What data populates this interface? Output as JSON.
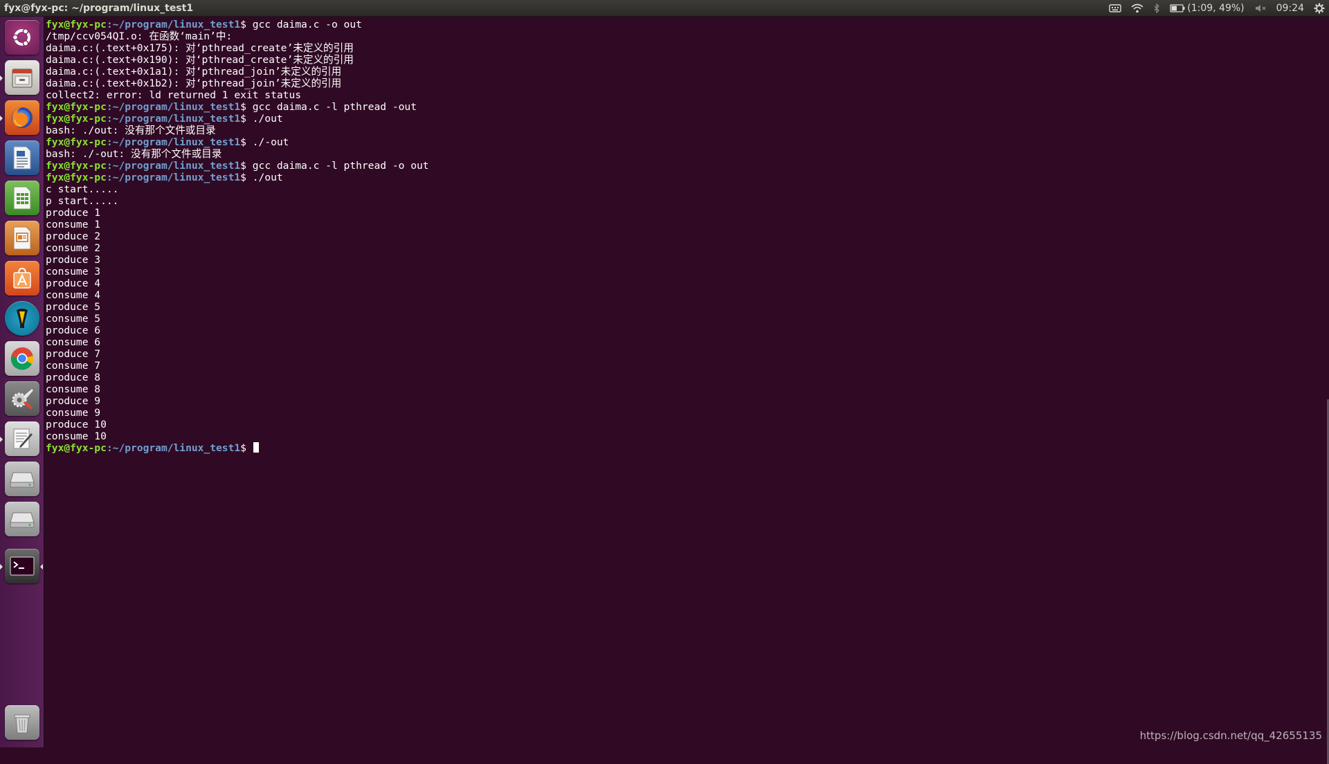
{
  "topbar": {
    "window_title": "fyx@fyx-pc: ~/program/linux_test1",
    "battery_text": "(1:09, 49%)",
    "clock": "09:24",
    "icons": [
      "keyboard-icon",
      "wifi-icon",
      "bluetooth-icon",
      "battery-icon",
      "volume-muted-icon",
      "gear-icon"
    ]
  },
  "launcher": {
    "items": [
      {
        "name": "ubuntu-dash",
        "icon": "ubuntu-logo-icon"
      },
      {
        "name": "files",
        "icon": "file-cabinet-icon"
      },
      {
        "name": "firefox",
        "icon": "firefox-icon"
      },
      {
        "name": "libreoffice-writer",
        "icon": "document-icon"
      },
      {
        "name": "libreoffice-calc",
        "icon": "spreadsheet-icon"
      },
      {
        "name": "libreoffice-impress",
        "icon": "presentation-icon"
      },
      {
        "name": "software-center",
        "icon": "shopping-bag-icon"
      },
      {
        "name": "app-teal",
        "icon": "pen-tool-icon"
      },
      {
        "name": "chrome",
        "icon": "chrome-icon"
      },
      {
        "name": "system-settings",
        "icon": "settings-tools-icon"
      },
      {
        "name": "text-editor",
        "icon": "text-editor-icon"
      },
      {
        "name": "disk-1",
        "icon": "disk-drive-icon"
      },
      {
        "name": "disk-2",
        "icon": "disk-drive-icon"
      },
      {
        "name": "terminal",
        "icon": "terminal-icon"
      }
    ],
    "trash": {
      "name": "trash",
      "icon": "trash-icon"
    }
  },
  "terminal": {
    "prompt_user": "fyx@fyx-pc",
    "prompt_path": ":~/program/linux_test1",
    "prompt_dollar": "$ ",
    "lines": [
      {
        "kind": "cmd",
        "text": "gcc daima.c -o out"
      },
      {
        "kind": "out",
        "text": "/tmp/ccv054QI.o: 在函数‘main’中:"
      },
      {
        "kind": "out",
        "text": "daima.c:(.text+0x175): 对‘pthread_create’未定义的引用"
      },
      {
        "kind": "out",
        "text": "daima.c:(.text+0x190): 对‘pthread_create’未定义的引用"
      },
      {
        "kind": "out",
        "text": "daima.c:(.text+0x1a1): 对‘pthread_join’未定义的引用"
      },
      {
        "kind": "out",
        "text": "daima.c:(.text+0x1b2): 对‘pthread_join’未定义的引用"
      },
      {
        "kind": "out",
        "text": "collect2: error: ld returned 1 exit status"
      },
      {
        "kind": "cmd",
        "text": "gcc daima.c -l pthread -out"
      },
      {
        "kind": "cmd",
        "text": "./out"
      },
      {
        "kind": "out",
        "text": "bash: ./out: 没有那个文件或目录"
      },
      {
        "kind": "cmd",
        "text": "./-out"
      },
      {
        "kind": "out",
        "text": "bash: ./-out: 没有那个文件或目录"
      },
      {
        "kind": "cmd",
        "text": "gcc daima.c -l pthread -o out"
      },
      {
        "kind": "cmd",
        "text": "./out"
      },
      {
        "kind": "out",
        "text": "c start....."
      },
      {
        "kind": "out",
        "text": "p start....."
      },
      {
        "kind": "out",
        "text": "produce 1"
      },
      {
        "kind": "out",
        "text": "consume 1"
      },
      {
        "kind": "out",
        "text": "produce 2"
      },
      {
        "kind": "out",
        "text": "consume 2"
      },
      {
        "kind": "out",
        "text": "produce 3"
      },
      {
        "kind": "out",
        "text": "consume 3"
      },
      {
        "kind": "out",
        "text": "produce 4"
      },
      {
        "kind": "out",
        "text": "consume 4"
      },
      {
        "kind": "out",
        "text": "produce 5"
      },
      {
        "kind": "out",
        "text": "consume 5"
      },
      {
        "kind": "out",
        "text": "produce 6"
      },
      {
        "kind": "out",
        "text": "consume 6"
      },
      {
        "kind": "out",
        "text": "produce 7"
      },
      {
        "kind": "out",
        "text": "consume 7"
      },
      {
        "kind": "out",
        "text": "produce 8"
      },
      {
        "kind": "out",
        "text": "consume 8"
      },
      {
        "kind": "out",
        "text": "produce 9"
      },
      {
        "kind": "out",
        "text": "consume 9"
      },
      {
        "kind": "out",
        "text": "produce 10"
      },
      {
        "kind": "out",
        "text": "consume 10"
      },
      {
        "kind": "prompt",
        "text": ""
      }
    ]
  },
  "watermark": "https://blog.csdn.net/qq_42655135",
  "colors": {
    "terminal_bg": "#300a24",
    "prompt_user": "#8ae234",
    "prompt_path": "#729fcf",
    "text": "#ffffff"
  }
}
